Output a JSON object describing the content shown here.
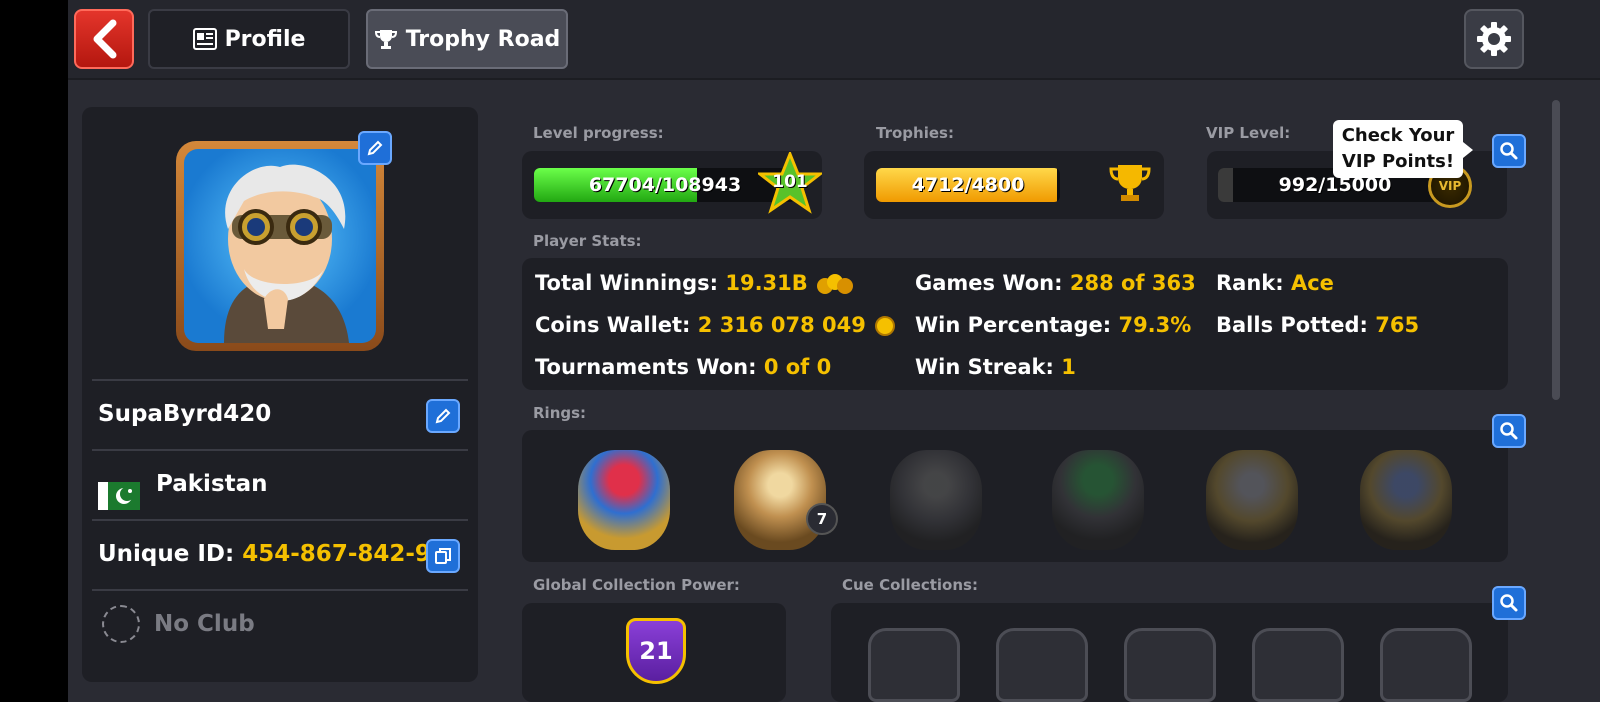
{
  "topbar": {
    "back_icon": "chevron-left-icon",
    "tabs": [
      {
        "label": "Profile",
        "icon": "profile-card-icon"
      },
      {
        "label": "Trophy Road",
        "icon": "trophy-icon"
      }
    ],
    "settings_icon": "gear-icon"
  },
  "profile": {
    "username": "SupaByrd420",
    "country": "Pakistan",
    "unique_id_label": "Unique ID:",
    "unique_id": "454-867-842-9",
    "club": "No Club"
  },
  "level": {
    "label": "Level progress:",
    "value": "67704/108943",
    "fraction": 0.6215,
    "level": "101"
  },
  "trophies": {
    "label": "Trophies:",
    "value": "4712/4800",
    "fraction": 0.9817
  },
  "vip": {
    "label": "VIP Level:",
    "value": "992/15000",
    "fraction": 0.0661,
    "tooltip_line1": "Check Your",
    "tooltip_line2": "VIP Points!",
    "badge": "VIP"
  },
  "player_stats": {
    "title": "Player Stats:",
    "total_winnings_label": "Total Winnings:",
    "total_winnings": "19.31B",
    "coins_wallet_label": "Coins Wallet:",
    "coins_wallet": "2 316 078 049",
    "tournaments_won_label": "Tournaments Won:",
    "tournaments_won": "0 of 0",
    "games_won_label": "Games Won:",
    "games_won": "288 of 363",
    "win_percentage_label": "Win Percentage:",
    "win_percentage": "79.3%",
    "win_streak_label": "Win Streak:",
    "win_streak": "1",
    "rank_label": "Rank:",
    "rank": "Ace",
    "balls_potted_label": "Balls Potted:",
    "balls_potted": "765"
  },
  "rings": {
    "title": "Rings:",
    "ring2_count": "7"
  },
  "global_collection": {
    "title": "Global Collection Power:",
    "value": "21"
  },
  "cue_collections": {
    "title": "Cue Collections:"
  },
  "colors": {
    "level_bar": "#3fd12a",
    "trophy_bar": "#f5b800",
    "accent_yellow": "#f5c000",
    "button_blue": "#1f6fd8"
  }
}
